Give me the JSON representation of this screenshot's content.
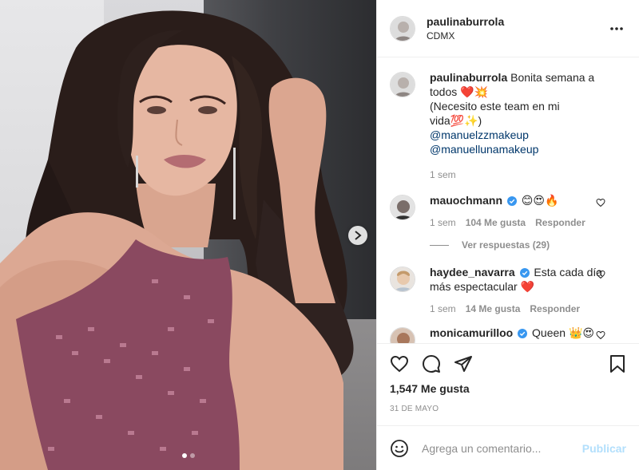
{
  "post": {
    "author": "paulinaburrola",
    "location": "CDMX",
    "more_icon": "ellipsis-icon"
  },
  "caption": {
    "username": "paulinaburrola",
    "text_line1": "Bonita semana a todos ❤️💥",
    "text_line2": "(Necesito este team en mi vida💯✨)",
    "mention1": "@manuelzzmakeup",
    "mention2": "@manuellunamakeup",
    "time": "1 sem"
  },
  "comments": [
    {
      "username": "mauochmann",
      "verified": true,
      "text": "😊😍🔥",
      "time": "1 sem",
      "likes": "104 Me gusta",
      "reply": "Responder"
    },
    {
      "username": "haydee_navarra",
      "verified": true,
      "text": "Esta cada día más espectacular ❤️",
      "time": "1 sem",
      "likes": "14 Me gusta",
      "reply": "Responder"
    },
    {
      "username": "monicamurilloo",
      "verified": true,
      "text": "Queen 👑😍"
    }
  ],
  "view_replies": "Ver respuestas (29)",
  "actions": {
    "likes_count": "1,547 Me gusta",
    "date": "31 DE MAYO"
  },
  "add_comment": {
    "placeholder": "Agrega un comentario...",
    "publish_label": "Publicar"
  },
  "carousel": {
    "slides": 2,
    "active": 1
  }
}
